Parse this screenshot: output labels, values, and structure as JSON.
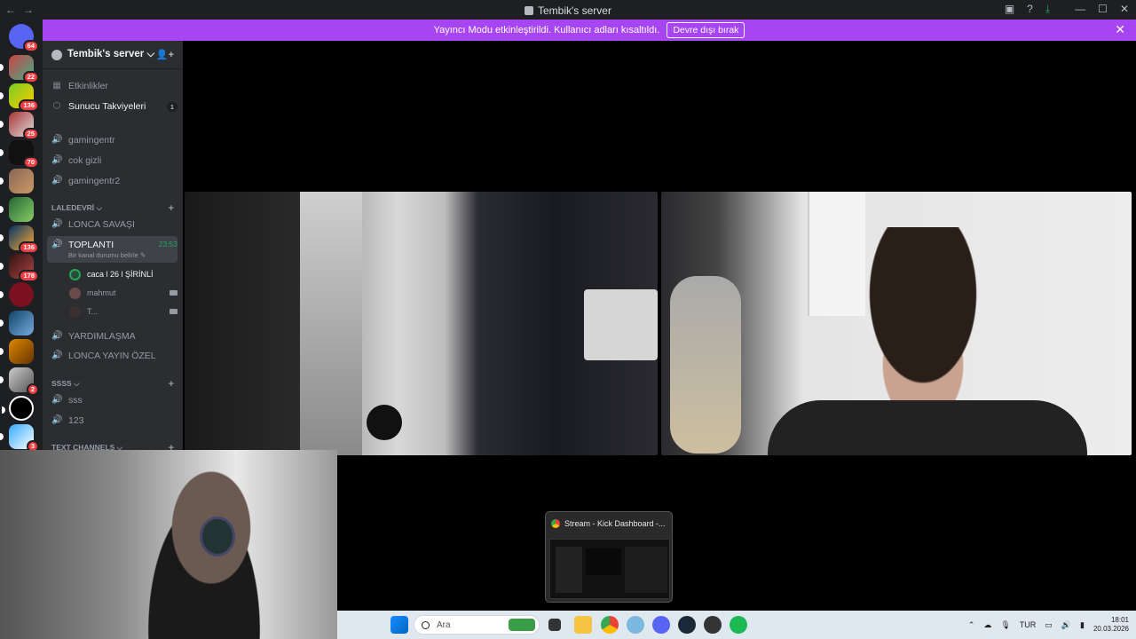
{
  "window": {
    "title": "Tembik's server",
    "back": "←",
    "forward": "→"
  },
  "banner": {
    "message": "Yayıncı Modu etkinleştirildi. Kullanıcı adları kısaltıldı.",
    "button": "Devre dışı bırak",
    "close": "✕"
  },
  "rail": {
    "badges": [
      "64",
      "22",
      "136",
      "25",
      "70",
      "",
      "",
      "136",
      "178",
      "",
      "",
      "",
      "2",
      "",
      "3"
    ]
  },
  "sidebar": {
    "server_name": "Tembik's server ⌵",
    "top_items": [
      {
        "label": "Etkinlikler",
        "icon": "calendar-icon"
      },
      {
        "label": "Sunucu Takviyeleri",
        "icon": "boost-icon",
        "count": "1"
      }
    ],
    "voice_channels_top": [
      "gamingentr",
      "cok gizli",
      "gamingentr2"
    ],
    "category1": {
      "name": "LALEDEVRİ ⌵",
      "channels": [
        "LONCA SAVAŞI"
      ]
    },
    "active_channel": {
      "name": "TOPLANTI",
      "timer": "23:53",
      "status": "Bir kanal durumu belirle ✎"
    },
    "members": [
      {
        "name": "caca l 26 l ŞİRİNLİ",
        "camera": false
      },
      {
        "name": "mahmut",
        "camera": true
      },
      {
        "name": "T...",
        "camera": true
      }
    ],
    "more_channels": [
      "YARDIMLAŞMA",
      "LONCA YAYIN ÖZEL"
    ],
    "category2": {
      "name": "ssss ⌵",
      "channels": [
        "sss",
        "123"
      ]
    },
    "category3": {
      "name": "Text Channels ⌵"
    }
  },
  "stream_preview": {
    "title": "Stream - Kick Dashboard -..."
  },
  "taskbar": {
    "search_placeholder": "Ara",
    "language": "TUR",
    "time": "18:01",
    "date": "20.03.2026"
  },
  "colors": {
    "banner": "#a845f3",
    "sidebar": "#2b2d31",
    "rail": "#1e1f22",
    "accent_green": "#23a55a",
    "badge_red": "#f23f43"
  }
}
